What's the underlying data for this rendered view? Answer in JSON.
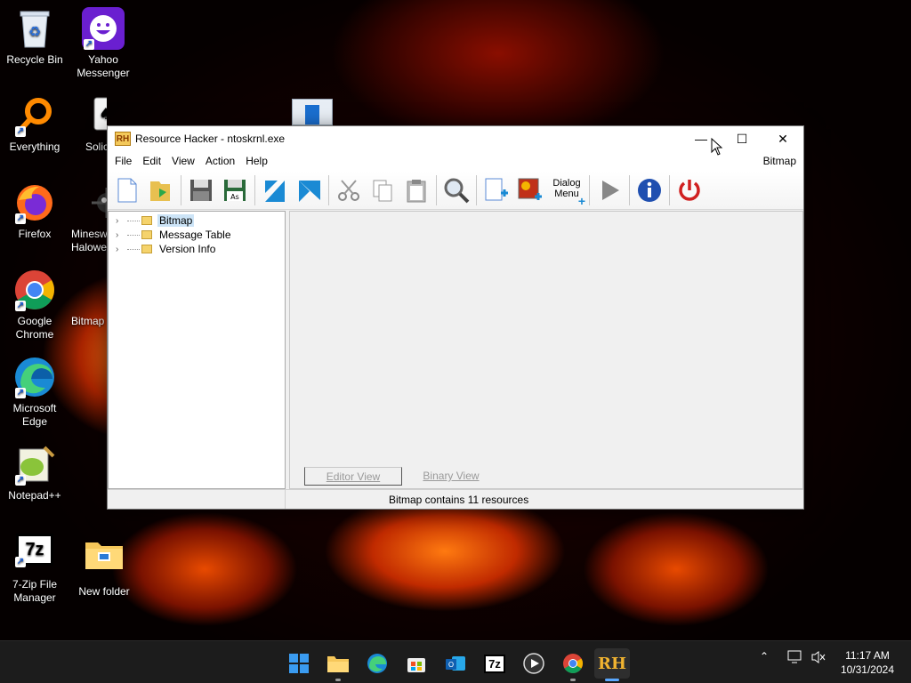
{
  "desktop": {
    "icons": [
      {
        "label": "Recycle Bin"
      },
      {
        "label": "Yahoo Messenger"
      },
      {
        "label": "Everything"
      },
      {
        "label": "Solic"
      },
      {
        "label": "Firefox"
      },
      {
        "label": "Minesw Halowe"
      },
      {
        "label": "Google Chrome"
      },
      {
        "label": "Bitmap"
      },
      {
        "label": "Microsoft Edge"
      },
      {
        "label": "Notepad++"
      },
      {
        "label": "7-Zip File Manager"
      },
      {
        "label": "New folder"
      }
    ]
  },
  "window": {
    "title": "Resource Hacker - ntoskrnl.exe",
    "app_icon_text": "RH",
    "controls": {
      "minimize": "—",
      "maximize": "☐",
      "close": "✕"
    },
    "menu": [
      "File",
      "Edit",
      "View",
      "Action",
      "Help"
    ],
    "menu_right": "Bitmap",
    "toolbar": {
      "dialog_label_1": "Dialog",
      "dialog_label_2": "Menu"
    },
    "tree": [
      {
        "label": "Bitmap",
        "selected": true
      },
      {
        "label": "Message Table",
        "selected": false
      },
      {
        "label": "Version Info",
        "selected": false
      }
    ],
    "tabs": [
      "Editor View",
      "Binary View"
    ],
    "status": "Bitmap contains 11 resources"
  },
  "taskbar": {
    "apps": [
      "start",
      "file-explorer",
      "edge",
      "store",
      "outlook",
      "7zip",
      "media-player",
      "chrome",
      "resource-hacker"
    ],
    "rh_text": "RH",
    "sevenzip_text": "7z",
    "time": "11:17 AM",
    "date": "10/31/2024"
  },
  "colors": {
    "accent": "#0078d4",
    "selection": "#cce4f7",
    "taskbar": "#1c1c1c"
  }
}
